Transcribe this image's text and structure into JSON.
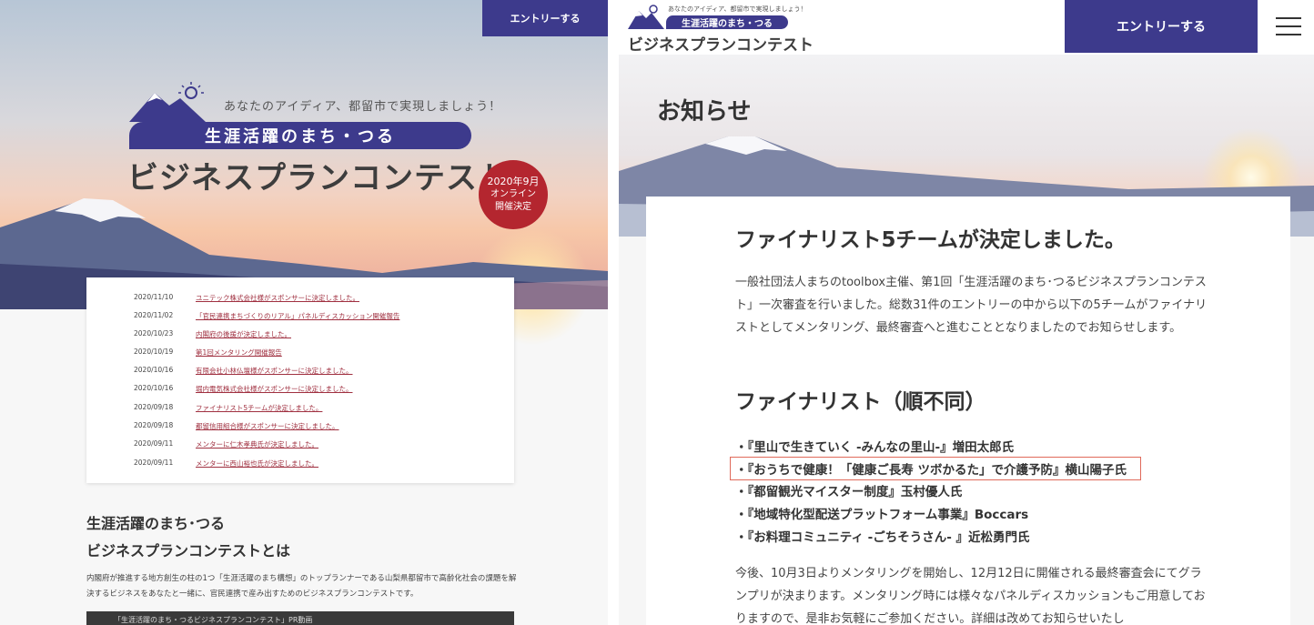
{
  "entry_label": "エントリーする",
  "tagline": "あなたのアイディア、都留市で実現しましょう！",
  "pill_text": "生涯活躍のまち・つる",
  "logo_title": "ビジネスプランコンテスト",
  "badge": {
    "line1": "2020年9月",
    "line2": "オンライン",
    "line3": "開催決定"
  },
  "news": [
    {
      "date": "2020/11/10",
      "title": "ユニテック株式会社様がスポンサーに決定しました。"
    },
    {
      "date": "2020/11/02",
      "title": "「官民連携まちづくりのリアル」パネルディスカッション開催報告"
    },
    {
      "date": "2020/10/23",
      "title": "内閣府の後援が決定しました。"
    },
    {
      "date": "2020/10/19",
      "title": "第1回メンタリング開催報告"
    },
    {
      "date": "2020/10/16",
      "title": "有限会社小林仏壇様がスポンサーに決定しました。"
    },
    {
      "date": "2020/10/16",
      "title": "堀内電気株式会社様がスポンサーに決定しました。"
    },
    {
      "date": "2020/09/18",
      "title": "ファイナリスト5チームが決定しました。"
    },
    {
      "date": "2020/09/18",
      "title": "都留信用組合様がスポンサーに決定しました。"
    },
    {
      "date": "2020/09/11",
      "title": "メンターに仁木孝典氏が決定しました。"
    },
    {
      "date": "2020/09/11",
      "title": "メンターに西山裕也氏が決定しました。"
    }
  ],
  "about": {
    "heading1": "生涯活躍のまち･つる",
    "heading2": "ビジネスプランコンテストとは",
    "body": "内閣府が推進する地方創生の柱の1つ「生涯活躍のまち構想」のトップランナーである山梨県都留市で高齢化社会の課題を解決するビジネスをあなたと一緒に、官民連携で産み出すためのビジネスプランコンテストです。",
    "video_title": "「生涯活躍のまち・つるビジネスプランコンテスト」PR動画"
  },
  "right": {
    "page_title": "お知らせ",
    "article_title": "ファイナリスト5チームが決定しました。",
    "intro": "一般社団法人まちのtoolbox主催、第1回「生涯活躍のまち･つるビジネスプランコンテスト」一次審査を行いました。総数31件のエントリーの中から以下の5チームがファイナリストとしてメンタリング、最終審査へと進むこととなりましたのでお知らせします。",
    "finalists_heading": "ファイナリスト（順不同）",
    "finalists": [
      "・『里山で生きていく -みんなの里山-』増田太郎氏",
      "・『おうちで健康！「健康ご長寿 ツボかるた」で介護予防』横山陽子氏",
      "・『都留観光マイスター制度』玉村優人氏",
      "・『地域特化型配送プラットフォーム事業』Boccars",
      "・『お料理コミュニティ -ごちそうさん- 』近松勇門氏"
    ],
    "outro": "今後、10月3日よりメンタリングを開始し、12月12日に開催される最終審査会にてグランプリが決まります。メンタリング時には様々なパネルディスカッションもご用意しておりますので、是非お気軽にご参加ください。詳細は改めてお知らせいたし"
  }
}
